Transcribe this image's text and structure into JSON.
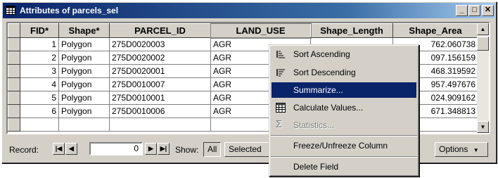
{
  "window": {
    "title": "Attributes of parcels_sel",
    "min_label": "_",
    "max_label": "□",
    "close_label": "✕",
    "colors": {
      "titlebar": "#0a246a",
      "menu_highlight": "#0a246a"
    }
  },
  "table": {
    "columns": [
      "FID*",
      "Shape*",
      "PARCEL_ID",
      "LAND_USE",
      "Shape_Length",
      "Shape_Area"
    ],
    "selected_column": "LAND_USE",
    "rows": [
      {
        "fid": "1",
        "shape": "Polygon",
        "parcel_id": "275D0020003",
        "land_use": "AGR",
        "area": "762.060738"
      },
      {
        "fid": "2",
        "shape": "Polygon",
        "parcel_id": "275D0020002",
        "land_use": "AGR",
        "area": "097.156159"
      },
      {
        "fid": "3",
        "shape": "Polygon",
        "parcel_id": "275D0020001",
        "land_use": "AGR",
        "area": "468.319592"
      },
      {
        "fid": "4",
        "shape": "Polygon",
        "parcel_id": "275D0010007",
        "land_use": "AGR",
        "area": "957.497676"
      },
      {
        "fid": "5",
        "shape": "Polygon",
        "parcel_id": "275D0010001",
        "land_use": "AGR",
        "area": "024.909162"
      },
      {
        "fid": "6",
        "shape": "Polygon",
        "parcel_id": "275D0010006",
        "land_use": "AGR",
        "area": "671.348813"
      }
    ]
  },
  "navigation": {
    "record_label": "Record:",
    "record_value": "0",
    "show_label": "Show:",
    "all_label": "All",
    "selected_label": "Selected",
    "options_label": "Options"
  },
  "context_menu": {
    "items": [
      {
        "label": "Sort Ascending",
        "icon": "sort-ascending-icon"
      },
      {
        "label": "Sort Descending",
        "icon": "sort-descending-icon"
      },
      {
        "label": "Summarize...",
        "highlighted": true
      },
      {
        "label": "Calculate Values...",
        "icon": "calculator-icon"
      },
      {
        "label": "Statistics...",
        "icon": "sigma-icon",
        "disabled": true
      },
      {
        "label": "Freeze/Unfreeze Column"
      },
      {
        "label": "Delete Field"
      }
    ]
  }
}
